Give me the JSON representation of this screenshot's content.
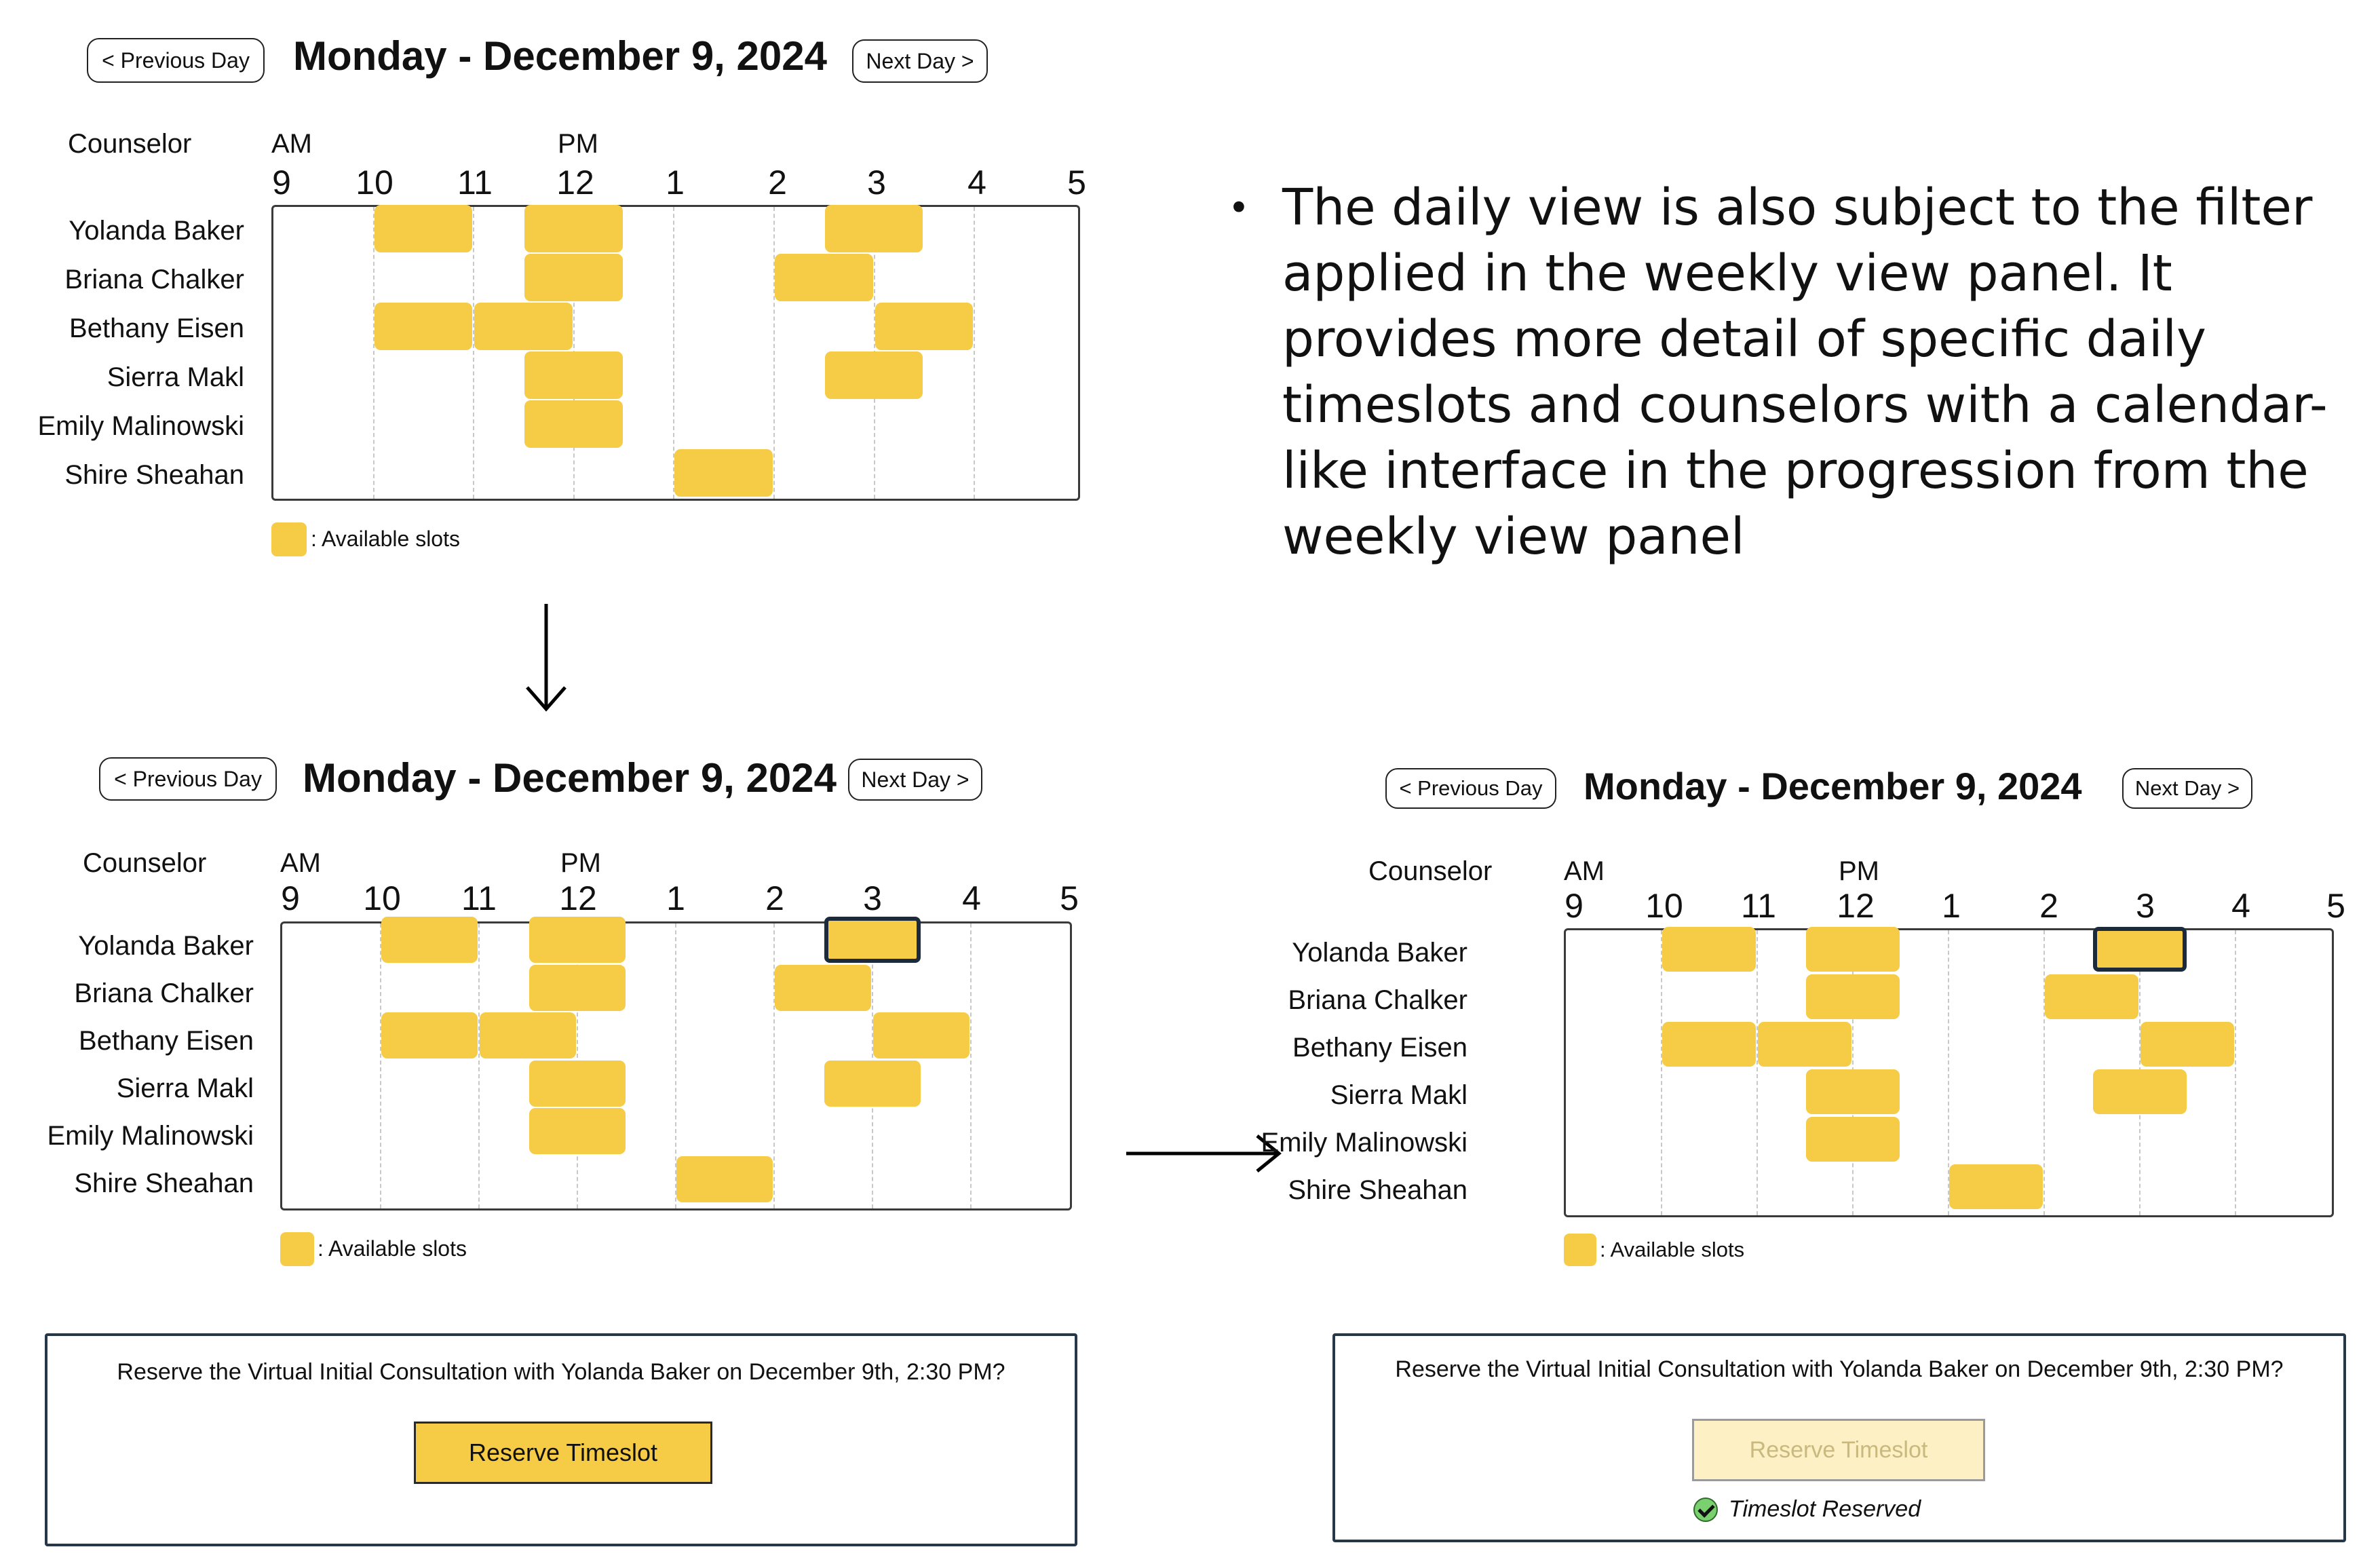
{
  "panel": {
    "prev_label": "< Previous Day",
    "next_label": "Next Day >",
    "date_title": "Monday - December 9, 2024",
    "counselor_header": "Counselor",
    "am_label": "AM",
    "pm_label": "PM",
    "hours": [
      "9",
      "10",
      "11",
      "12",
      "1",
      "2",
      "3",
      "4",
      "5"
    ],
    "counselors": [
      "Yolanda Baker",
      "Briana Chalker",
      "Bethany Eisen",
      "Sierra Makl",
      "Emily Malinowski",
      "Shire Sheahan"
    ],
    "legend_label": ": Available slots"
  },
  "schedule": {
    "unit": "hour offset from 9 AM",
    "rows": [
      {
        "name": "Yolanda Baker",
        "slots": [
          [
            1,
            2
          ],
          [
            2.5,
            3.5
          ],
          [
            5.5,
            6.5
          ]
        ]
      },
      {
        "name": "Briana Chalker",
        "slots": [
          [
            2.5,
            3.5
          ],
          [
            5,
            6
          ]
        ]
      },
      {
        "name": "Bethany Eisen",
        "slots": [
          [
            1,
            2
          ],
          [
            2,
            3
          ],
          [
            6,
            7
          ]
        ]
      },
      {
        "name": "Sierra Makl",
        "slots": [
          [
            2.5,
            3.5
          ],
          [
            5.5,
            6.5
          ]
        ]
      },
      {
        "name": "Emily Malinowski",
        "slots": [
          [
            2.5,
            3.5
          ]
        ]
      },
      {
        "name": "Shire Sheahan",
        "slots": [
          [
            4,
            5
          ]
        ]
      }
    ],
    "selected": {
      "row": 0,
      "slot": 2
    }
  },
  "confirmation": {
    "question": "Reserve the Virtual Initial Consultation with Yolanda Baker on December 9th, 2:30 PM?",
    "reserve_label": "Reserve Timeslot",
    "reserved_label": "Timeslot Reserved"
  },
  "description": {
    "text": "The daily view is also subject to the filter applied in the weekly view panel. It provides more detail of specific daily timeslots and counselors with a calendar-like interface in the progression from the weekly view panel"
  },
  "colors": {
    "slot": "#f6cb45",
    "selected_border": "#1b2b3c",
    "disabled_button": "#fcf0c4",
    "check": "#7ad06f"
  },
  "icons": [
    "down-arrow-icon",
    "right-arrow-icon",
    "check-circle-icon"
  ]
}
